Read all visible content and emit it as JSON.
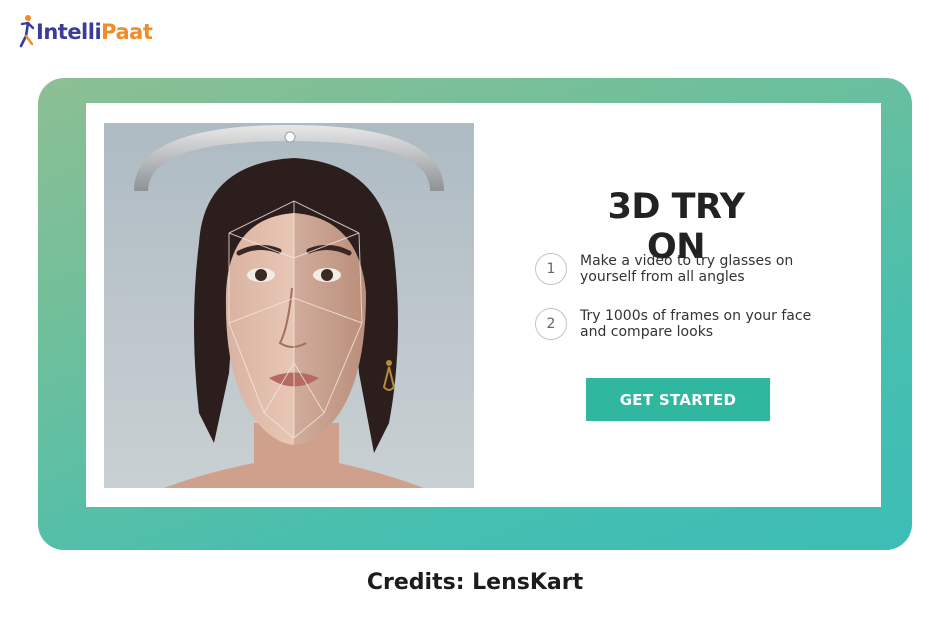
{
  "brand": {
    "logo_text_i": "I",
    "logo_text_ntelli": "ntelli",
    "logo_text_paat": "Paat",
    "colors": {
      "indigo": "#3b3b9a",
      "orange": "#f28c28"
    }
  },
  "promo": {
    "title": "3D TRY ON",
    "steps": [
      {
        "number": "1",
        "line1": "Make a video to try glasses on",
        "line2": "yourself from all angles"
      },
      {
        "number": "2",
        "line1": "Try 1000s of frames on your face",
        "line2": "and compare looks"
      }
    ],
    "cta_label": "GET STARTED",
    "colors": {
      "accent": "#2fb7a0",
      "frame_top": "#8dbf93",
      "frame_bottom": "#3dbdb6"
    },
    "image": "face-scan-photo"
  },
  "credits": "Credits: LensKart"
}
